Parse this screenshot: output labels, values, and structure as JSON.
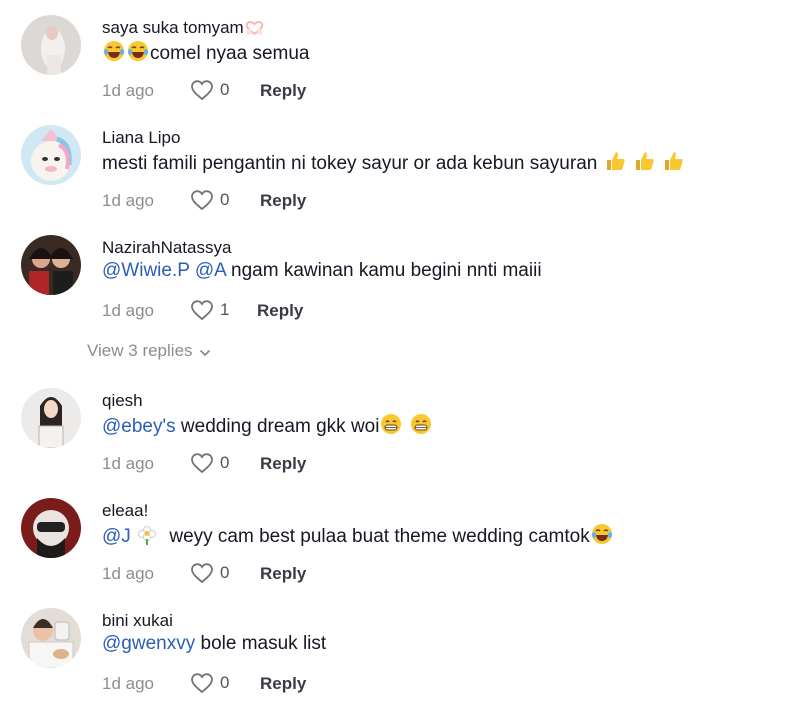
{
  "comments": [
    {
      "username": "saya suka tomyam",
      "text": "comel nyaa semua",
      "time": "1d ago",
      "likes": "0",
      "reply_label": "Reply"
    },
    {
      "username": "Liana Lipo",
      "text": "mesti famili pengantin ni tokey sayur or ada kebun sayuran",
      "time": "1d ago",
      "likes": "0",
      "reply_label": "Reply"
    },
    {
      "username": "NazirahNatassya",
      "mention1": "@Wiwie.P",
      "mention2": "@A",
      "text": "ngam kawinan kamu begini nnti maiii",
      "time": "1d ago",
      "likes": "1",
      "reply_label": "Reply"
    },
    {
      "username": "qiesh",
      "mention": "@ebey's",
      "text": "wedding dream gkk woi",
      "time": "1d ago",
      "likes": "0",
      "reply_label": "Reply"
    },
    {
      "username": "eleaa!",
      "mention": "@J",
      "text": "weyy cam best pulaa buat theme wedding camtok",
      "time": "1d ago",
      "likes": "0",
      "reply_label": "Reply"
    },
    {
      "username": "bini xukai",
      "mention": "@gwenxvy",
      "text": "bole masuk list",
      "time": "1d ago",
      "likes": "0",
      "reply_label": "Reply"
    }
  ],
  "view_replies": "View 3 replies",
  "icons": {
    "like": "heart-outline-icon",
    "expand": "chevron-down-icon",
    "laugh": "face-with-tears-of-joy-emoji",
    "grin": "grinning-face-emoji",
    "thumbs": "thumbs-up-emoji",
    "heart_hands": "heart-hands-emoji",
    "flower": "flower-emoji"
  },
  "colors": {
    "text": "#161823",
    "mention": "#2b5db9",
    "muted": "rgba(22,24,35,0.5)"
  }
}
